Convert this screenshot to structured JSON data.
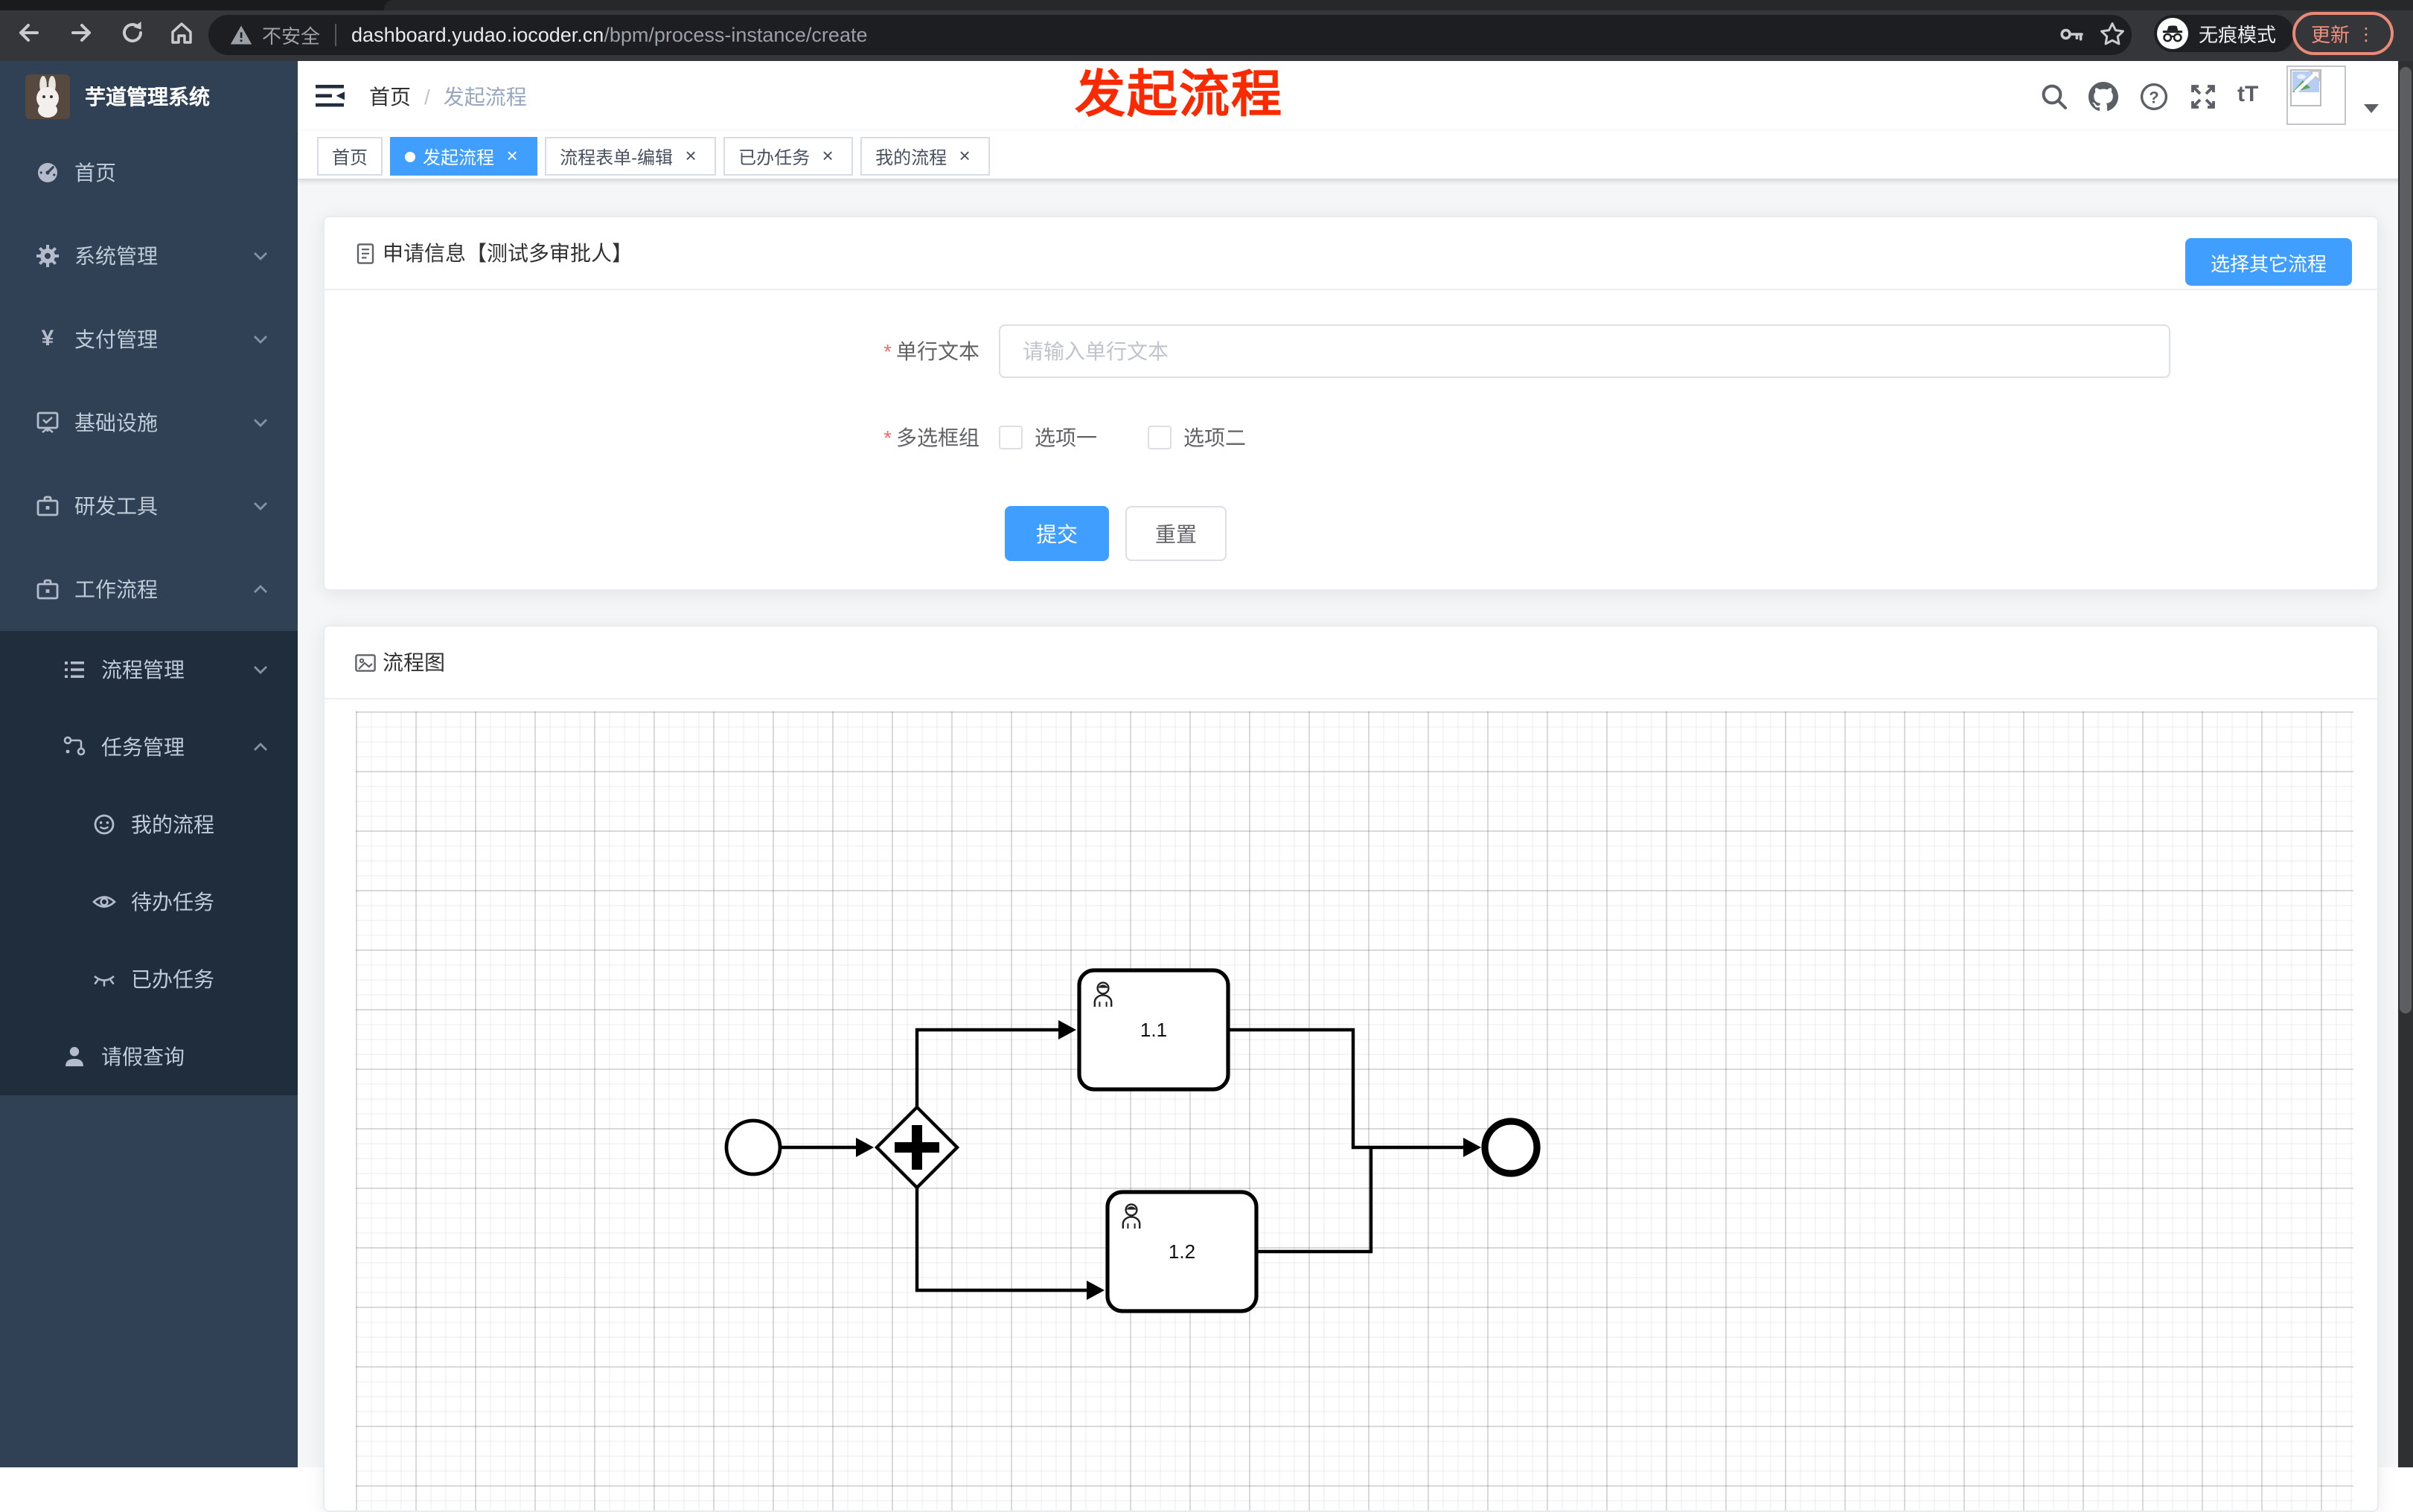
{
  "browser": {
    "security_label": "不安全",
    "url_host": "dashboard.yudao.iocoder.cn",
    "url_path": "/bpm/process-instance/create",
    "incognito_label": "无痕模式",
    "update_label": "更新"
  },
  "annotation": {
    "text": "发起流程",
    "color": "#fa2a00"
  },
  "glyphs": {
    "close": "×",
    "menu_dots": "⋮",
    "separator": "/",
    "required_mark": "*",
    "question": "?",
    "font_size": "tT"
  },
  "sidebar": {
    "logo_title": "芋道管理系统",
    "items": [
      {
        "label": "首页"
      },
      {
        "label": "系统管理"
      },
      {
        "label": "支付管理"
      },
      {
        "label": "基础设施"
      },
      {
        "label": "研发工具"
      },
      {
        "label": "工作流程"
      },
      {
        "label": "流程管理"
      },
      {
        "label": "任务管理"
      },
      {
        "label": "我的流程"
      },
      {
        "label": "待办任务"
      },
      {
        "label": "已办任务"
      },
      {
        "label": "请假查询"
      }
    ]
  },
  "header": {
    "breadcrumb": [
      "首页",
      "发起流程"
    ]
  },
  "tabs": [
    {
      "label": "首页",
      "active": false,
      "closable": false
    },
    {
      "label": "发起流程",
      "active": true,
      "closable": true
    },
    {
      "label": "流程表单-编辑",
      "active": false,
      "closable": true
    },
    {
      "label": "已办任务",
      "active": false,
      "closable": true
    },
    {
      "label": "我的流程",
      "active": false,
      "closable": true
    }
  ],
  "apply_card": {
    "title": "申请信息【测试多审批人】",
    "select_other_button": "选择其它流程",
    "fields": [
      {
        "label": "单行文本",
        "required": true,
        "placeholder": "请输入单行文本",
        "value": ""
      },
      {
        "label": "多选框组",
        "required": true,
        "options": [
          "选项一",
          "选项二"
        ],
        "checked": [
          false,
          false
        ]
      }
    ],
    "submit_label": "提交",
    "reset_label": "重置"
  },
  "diagram_card": {
    "title": "流程图",
    "nodes": [
      {
        "type": "start-event"
      },
      {
        "type": "parallel-gateway"
      },
      {
        "type": "user-task",
        "label": "1.1"
      },
      {
        "type": "user-task",
        "label": "1.2"
      },
      {
        "type": "end-event"
      }
    ]
  },
  "colors": {
    "accent": "#409eff",
    "sidebar_bg": "#304156",
    "submenu_bg": "#1f2d3d",
    "active_tab": "#409eff",
    "update_coral": "#f0907e",
    "annotation_red": "#fa2a00"
  }
}
